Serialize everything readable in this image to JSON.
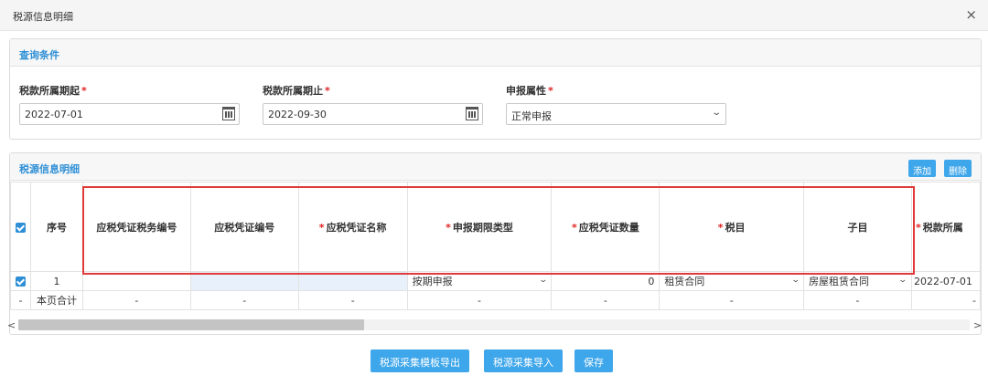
{
  "dialog": {
    "title": "税源信息明细",
    "close": "×"
  },
  "query": {
    "title": "查询条件",
    "start_label": "税款所属期起",
    "start_value": "2022-07-01",
    "end_label": "税款所属期止",
    "end_value": "2022-09-30",
    "attr_label": "申报属性",
    "attr_value": "正常申报",
    "required_mark": "*"
  },
  "detail": {
    "title": "税源信息明细",
    "add_label": "添加",
    "delete_label": "删除",
    "columns": [
      "序号",
      "应税凭证税务编号",
      "应税凭证编号",
      "应税凭证名称",
      "申报期限类型",
      "应税凭证数量",
      "税目",
      "子目",
      "税款所属"
    ],
    "row": {
      "index": "1",
      "period_type": "按期申报",
      "quantity": "0",
      "tax_item": "租赁合同",
      "sub_item": "房屋租赁合同",
      "tax_period": "2022-07-01"
    },
    "subtotal": {
      "check": "-",
      "label": "本页合计",
      "dash": "-"
    }
  },
  "footer": {
    "export_label": "税源采集模板导出",
    "import_label": "税源采集导入",
    "save_label": "保存"
  },
  "icons": {
    "calendar": "calendar-icon",
    "chevron": "chevron-down-icon",
    "checkbox": "checkbox-checked-icon"
  },
  "colors": {
    "accent": "#3ea6ea",
    "title": "#2e8fd6",
    "required": "#e02020",
    "highlight_box": "#e03a3a"
  }
}
